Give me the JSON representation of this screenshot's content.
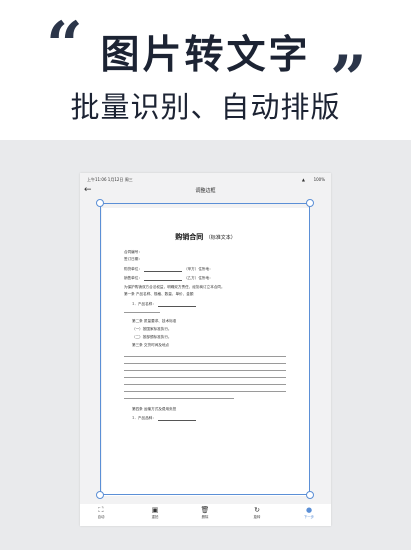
{
  "promo": {
    "quote_open": "“",
    "quote_close": "”",
    "title": "图片转文字",
    "subtitle": "批量识别、自动排版"
  },
  "status_bar": {
    "time": "上午11:06  1月12日 周三",
    "battery": "100%",
    "wifi": "▲"
  },
  "nav": {
    "back_icon": "←",
    "title": "调整边框"
  },
  "document": {
    "title": "购销合同",
    "title_note": "（标准文本）",
    "lines": [
      "合同编号：",
      "签订日期：",
      "购货单位：",
      "销售单位：",
      "为保护购销双方合法权益，明确双方责任，经协商订立本合同。",
      "第一条  产品名称、规格、数量、单价、金额",
      "1．产品名称：",
      "第二条  质量要求、技术标准",
      "（一）按国家标准执行。",
      "（二）按部颁标准执行。",
      "第三条  交货时间及地点",
      "第四条  运输方式及费用负担",
      "1．产品品种："
    ],
    "party_a_label": "（甲方）",
    "party_b_label": "（乙方）",
    "address_label": "住所地："
  },
  "toolbar": {
    "items": [
      {
        "icon": "⛶",
        "label": "自动"
      },
      {
        "icon": "▣",
        "label": "重拍"
      },
      {
        "icon": "🗑",
        "label": "删除"
      },
      {
        "icon": "↻",
        "label": "旋转"
      },
      {
        "icon": "●",
        "label": "下一步"
      }
    ]
  },
  "colors": {
    "accent": "#5b8fd6",
    "title_text": "#1c2333",
    "background": "#e9eaec"
  }
}
